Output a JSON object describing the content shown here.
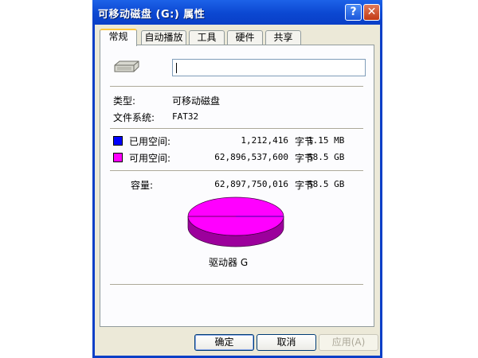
{
  "window": {
    "title": "可移动磁盘 (G:) 属性",
    "help_label": "?",
    "close_label": "✕"
  },
  "tabs": [
    {
      "label": "常规",
      "active": true
    },
    {
      "label": "自动播放",
      "active": false
    },
    {
      "label": "工具",
      "active": false
    },
    {
      "label": "硬件",
      "active": false
    },
    {
      "label": "共享",
      "active": false
    }
  ],
  "general": {
    "drive_icon": "removable-drive-icon",
    "name_value": "",
    "type_label": "类型:",
    "type_value": "可移动磁盘",
    "fs_label": "文件系统:",
    "fs_value": "FAT32",
    "used": {
      "label": "已用空间:",
      "bytes": "1,212,416",
      "unit": "字节",
      "size": "1.15 MB",
      "color": "#0000ff"
    },
    "free": {
      "label": "可用空间:",
      "bytes": "62,896,537,600",
      "unit": "字节",
      "size": "58.5 GB",
      "color": "#ff00ff"
    },
    "capacity": {
      "label": "容量:",
      "bytes": "62,897,750,016",
      "unit": "字节",
      "size": "58.5 GB"
    },
    "drive_label": "驱动器 G"
  },
  "chart_data": {
    "type": "pie",
    "labels": [
      "已用空间",
      "可用空间"
    ],
    "values": [
      1212416,
      62896537600
    ],
    "colors": [
      "#0000ff",
      "#ff00ff"
    ]
  },
  "buttons": {
    "ok": "确定",
    "cancel": "取消",
    "apply": "应用(A)"
  }
}
